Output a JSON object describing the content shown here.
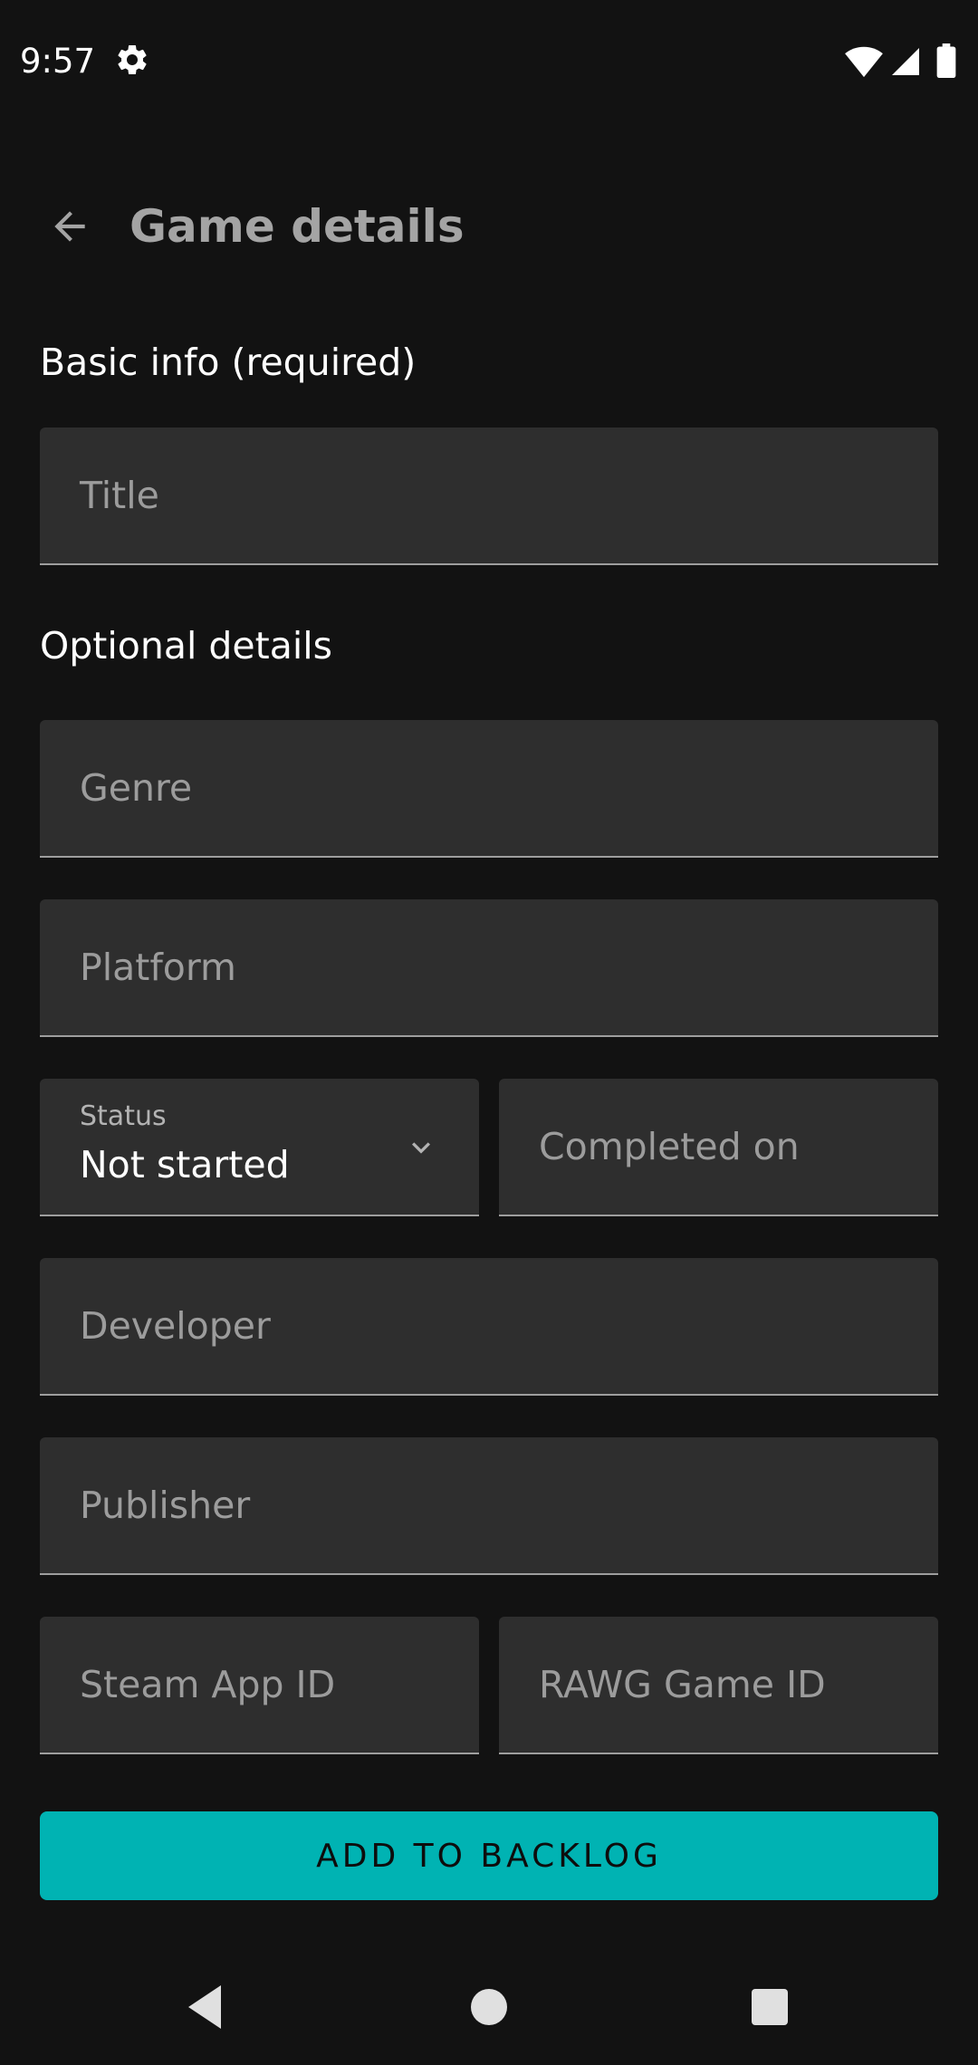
{
  "status_bar": {
    "time": "9:57",
    "icons": [
      "settings-icon",
      "wifi-icon",
      "cell-signal-icon",
      "battery-icon"
    ]
  },
  "app_bar": {
    "title": "Game details",
    "back_icon": "arrow-back-icon"
  },
  "sections": {
    "basic_info": "Basic info (required)",
    "optional_details": "Optional details"
  },
  "fields": {
    "title": {
      "placeholder": "Title"
    },
    "genre": {
      "placeholder": "Genre"
    },
    "platform": {
      "placeholder": "Platform"
    },
    "status": {
      "label": "Status",
      "value": "Not started"
    },
    "completed_on": {
      "placeholder": "Completed on"
    },
    "developer": {
      "placeholder": "Developer"
    },
    "publisher": {
      "placeholder": "Publisher"
    },
    "steam_app_id": {
      "placeholder": "Steam App ID"
    },
    "rawg_game_id": {
      "placeholder": "RAWG Game ID"
    }
  },
  "button": {
    "label": "ADD TO BACKLOG"
  },
  "colors": {
    "background": "#121212",
    "field_background": "#2e2e2e",
    "accent": "#00b3b3",
    "title_text": "#a4a4a4",
    "placeholder_text": "#9c9c9c"
  },
  "nav_bar": {
    "icons": [
      "nav-back-icon",
      "nav-home-icon",
      "nav-recents-icon"
    ]
  }
}
